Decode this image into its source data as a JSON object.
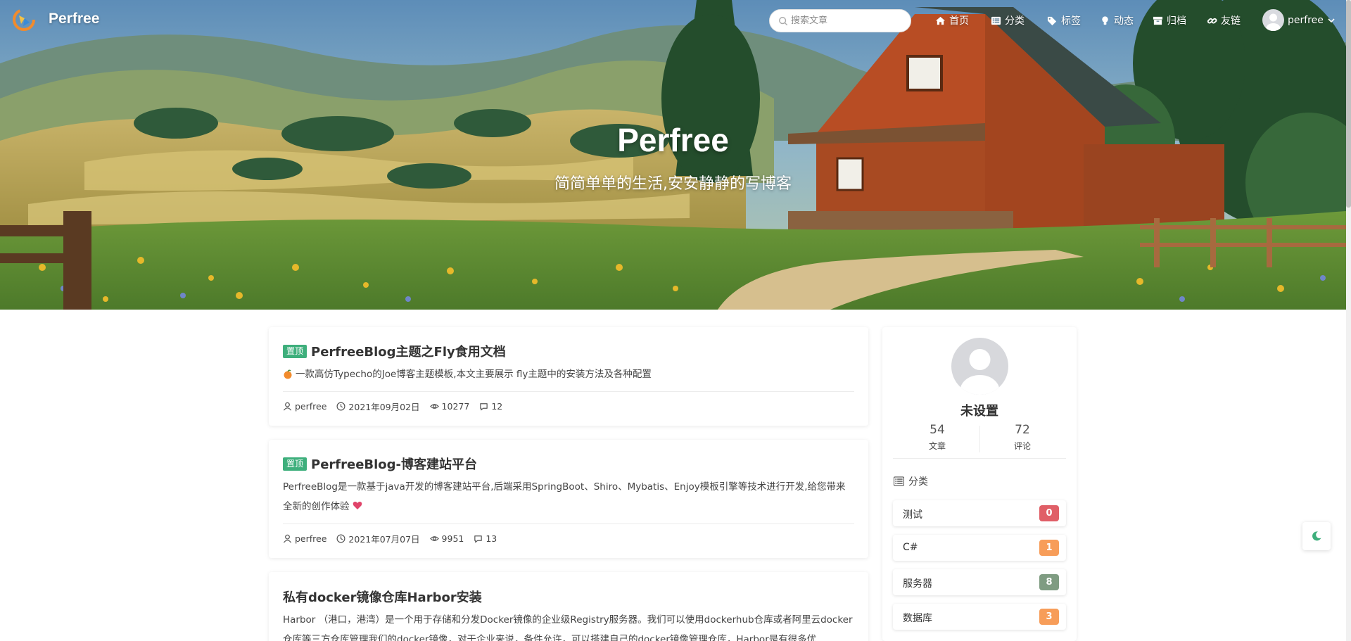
{
  "nav": {
    "brand": "Perfree",
    "search_placeholder": "搜索文章",
    "items": [
      {
        "label": "首页",
        "icon": "home-icon"
      },
      {
        "label": "分类",
        "icon": "list-icon"
      },
      {
        "label": "标签",
        "icon": "tags-icon"
      },
      {
        "label": "动态",
        "icon": "bulb-icon"
      },
      {
        "label": "归档",
        "icon": "archive-icon"
      },
      {
        "label": "友链",
        "icon": "link-icon"
      }
    ],
    "user": "perfree"
  },
  "hero": {
    "title": "Perfree",
    "subtitle": "简简单单的生活,安安静静的写博客"
  },
  "posts": [
    {
      "badge": "置顶",
      "title": "PerfreeBlog主题之Fly食用文档",
      "excerpt": "一款高仿Typecho的Joe博客主题模板,本文主要展示 fly主题中的安装方法及各种配置",
      "author": "perfree",
      "date": "2021年09月02日",
      "views": "10277",
      "comments": "12"
    },
    {
      "badge": "置顶",
      "title": "PerfreeBlog-博客建站平台",
      "excerpt": "PerfreeBlog是一款基于java开发的博客建站平台,后端采用SpringBoot、Shiro、Mybatis、Enjoy模板引擎等技术进行开发,给您带来全新的创作体验",
      "author": "perfree",
      "date": "2021年07月07日",
      "views": "9951",
      "comments": "13"
    },
    {
      "badge": "",
      "title": "私有docker镜像仓库Harbor安装",
      "excerpt": "Harbor （港口，港湾）是一个用于存储和分发Docker镜像的企业级Registry服务器。我们可以使用dockerhub仓库或者阿里云docker仓库等三方仓库管理我们的docker镜像，对于企业来说，备件允许，可以搭建自己的docker镜像管理仓库，Harbor是有很多优"
    }
  ],
  "sidebar": {
    "name": "未设置",
    "stats": [
      {
        "value": "54",
        "label": "文章"
      },
      {
        "value": "72",
        "label": "评论"
      }
    ],
    "category_heading": "分类",
    "categories": [
      {
        "label": "测试",
        "count": "0",
        "color": "#e05f67"
      },
      {
        "label": "C#",
        "count": "1",
        "color": "#f79d59"
      },
      {
        "label": "服务器",
        "count": "8",
        "color": "#7f9c82"
      },
      {
        "label": "数据库",
        "count": "3",
        "color": "#f79d59"
      }
    ]
  },
  "colors": {
    "accent": "#3eaf7c",
    "moon": "#3eaf7c"
  }
}
